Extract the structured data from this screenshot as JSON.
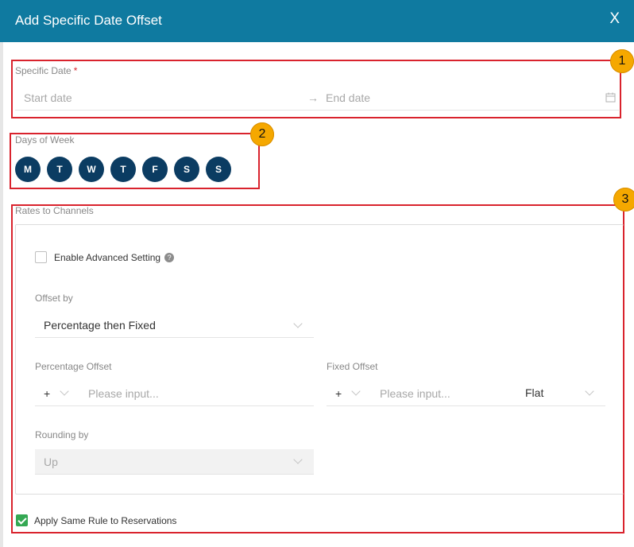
{
  "dialog": {
    "title": "Add Specific Date Offset",
    "close_label": "X"
  },
  "badges": [
    "1",
    "2",
    "3"
  ],
  "specific_date": {
    "label": "Specific Date",
    "required_mark": "*",
    "start_placeholder": "Start date",
    "arrow": "→",
    "end_placeholder": "End date"
  },
  "days_of_week": {
    "label": "Days of Week",
    "days": [
      "M",
      "T",
      "W",
      "T",
      "F",
      "S",
      "S"
    ]
  },
  "rates": {
    "label": "Rates to Channels",
    "advanced_label": "Enable Advanced Setting",
    "help_glyph": "?",
    "offset_by": {
      "label": "Offset by",
      "value": "Percentage then Fixed"
    },
    "percentage_offset": {
      "label": "Percentage Offset",
      "sign": "+",
      "placeholder": "Please input..."
    },
    "fixed_offset": {
      "label": "Fixed Offset",
      "sign": "+",
      "placeholder": "Please input...",
      "type": "Flat"
    },
    "rounding_by": {
      "label": "Rounding by",
      "value": "Up"
    }
  },
  "apply_same_rule": {
    "label": "Apply Same Rule to Reservations",
    "checked": true
  },
  "colors": {
    "header": "#0f7aa0",
    "day_button": "#0b3c62",
    "callout": "#d9232d",
    "badge": "#f5a800",
    "check": "#34a853"
  }
}
